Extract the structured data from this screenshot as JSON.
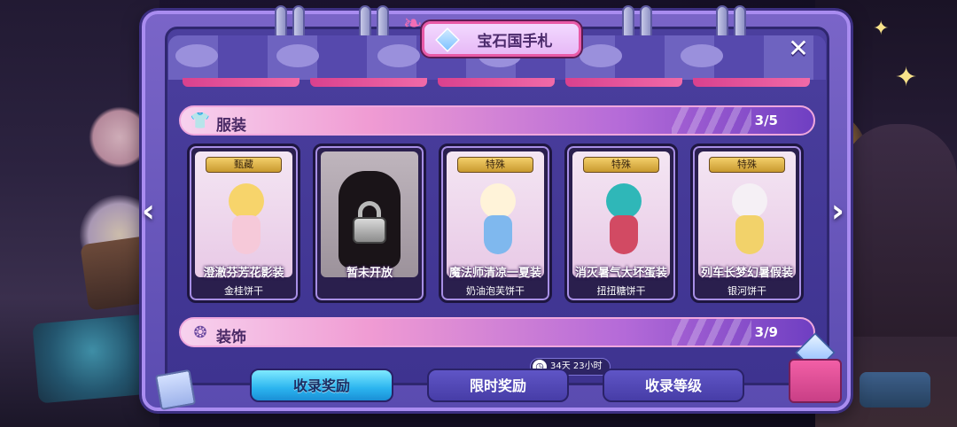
{
  "header": {
    "title": "宝石国手札"
  },
  "sections": [
    {
      "label": "服装",
      "count": "3/5"
    },
    {
      "label": "装饰",
      "count": "3/9"
    }
  ],
  "cards": [
    {
      "tag": "甄藏",
      "title": "澄澈芬芳花影装",
      "subtitle": "金桂饼干",
      "locked": false
    },
    {
      "tag": "",
      "title": "暂未开放",
      "subtitle": "",
      "locked": true
    },
    {
      "tag": "特殊",
      "title": "魔法师清凉一夏装",
      "subtitle": "奶油泡芙饼干",
      "locked": false
    },
    {
      "tag": "特殊",
      "title": "消灭暑气大坏蛋装",
      "subtitle": "扭扭糖饼干",
      "locked": false
    },
    {
      "tag": "特殊",
      "title": "列车长梦幻暑假装",
      "subtitle": "银河饼干",
      "locked": false
    }
  ],
  "buttons": {
    "collection_reward": "收录奖励",
    "limited_reward": "限时奖励",
    "collection_level": "收录等级"
  },
  "timer": {
    "text": "34天 23小时"
  },
  "icons": {
    "close": "close-icon",
    "prev": "chevron-left-icon",
    "next": "chevron-right-icon",
    "outfit": "shirt-icon",
    "decor": "decoration-icon",
    "title": "gem-icon",
    "timer": "clock-icon"
  },
  "colors": {
    "panel": "#5a4bb0",
    "accent_pink": "#f06aa8",
    "primary_button": "#2bb4ef",
    "tag_gold": "#f3cf6b"
  }
}
